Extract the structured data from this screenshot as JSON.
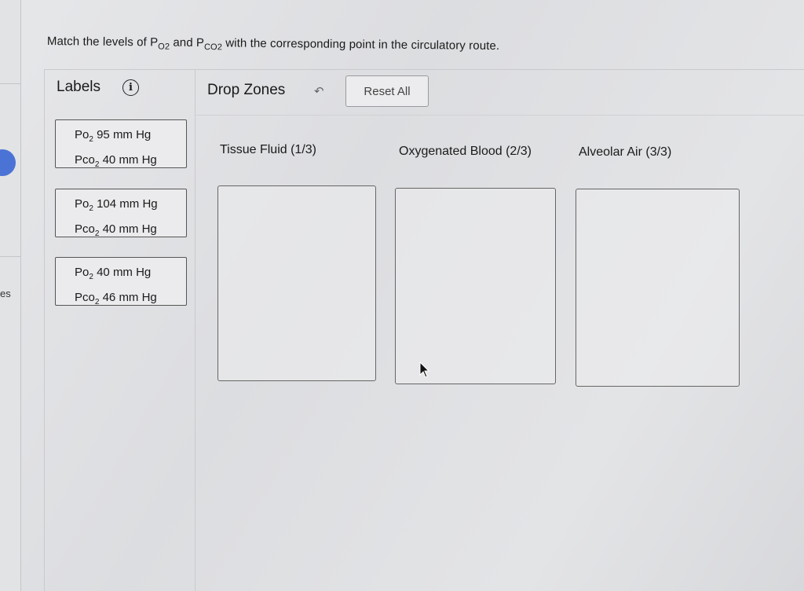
{
  "question": {
    "prefix": "Match the levels of P",
    "sub1": "O2",
    "middle": " and P",
    "sub2": "CO2",
    "suffix": " with the corresponding point in the circulatory route."
  },
  "labels_panel": {
    "title": "Labels",
    "info_icon": "info-icon"
  },
  "drop_zones_panel": {
    "title": "Drop Zones",
    "back_icon": "back-arrow-icon",
    "reset_label": "Reset All"
  },
  "cards": [
    {
      "po2_prefix": "Po",
      "po2_sub": "2",
      "po2_value": " 95 mm Hg",
      "pco2_prefix": "Pco",
      "pco2_sub": "2",
      "pco2_value": " 40 mm Hg"
    },
    {
      "po2_prefix": "Po",
      "po2_sub": "2",
      "po2_value": " 104 mm Hg",
      "pco2_prefix": "Pco",
      "pco2_sub": "2",
      "pco2_value": " 40 mm Hg"
    },
    {
      "po2_prefix": "Po",
      "po2_sub": "2",
      "po2_value": " 40 mm Hg",
      "pco2_prefix": "Pco",
      "pco2_sub": "2",
      "pco2_value": " 46 mm Hg"
    }
  ],
  "zones": [
    {
      "title": "Tissue Fluid (1/3)"
    },
    {
      "title": "Oxygenated Blood (2/3)"
    },
    {
      "title": "Alveolar Air (3/3)"
    }
  ],
  "rail": {
    "partial_text": "es"
  },
  "colors": {
    "accent_blue": "#4b73d6",
    "card_border": "#555555",
    "zone_border": "#666666"
  }
}
